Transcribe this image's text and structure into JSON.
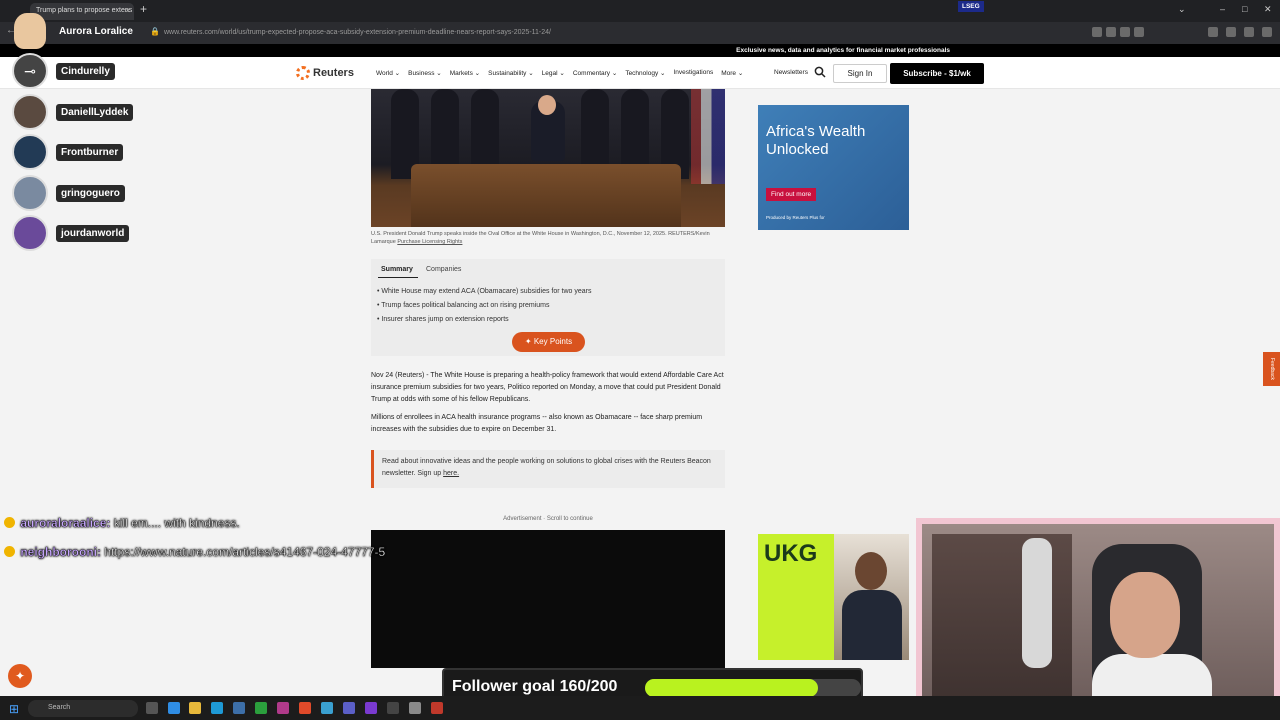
{
  "browser": {
    "tab_title": "Trump plans to propose extens",
    "tab_close": "×",
    "new_tab": "+",
    "url": "www.reuters.com/world/us/trump-expected-propose-aca-subsidy-extension-premium-deadline-nears-report-says-2025-11-24/"
  },
  "header": {
    "promo_text": "Exclusive news, data and analytics for financial market professionals",
    "promo_badge": "LSEG",
    "logo": "Reuters",
    "nav": [
      "World",
      "Business",
      "Markets",
      "Sustainability",
      "Legal",
      "Commentary",
      "Technology",
      "Investigations",
      "More"
    ],
    "newsletters": "Newsletters",
    "sign_in": "Sign In",
    "subscribe": "Subscribe - $1/wk"
  },
  "article": {
    "caption": "U.S. President Donald Trump speaks inside the Oval Office at the White House in Washington, D.C., November 12, 2025. REUTERS/Kevin Lamarque",
    "caption_link": "Purchase Licensing Rights",
    "tabs": {
      "summary": "Summary",
      "companies": "Companies"
    },
    "bullets": [
      "White House may extend ACA (Obamacare) subsidies for two years",
      "Trump faces political balancing act on rising premiums",
      "Insurer shares jump on extension reports"
    ],
    "key_points": "Key Points",
    "paragraphs": [
      "Nov 24 (Reuters) - The White House is preparing a health-policy framework that would extend Affordable Care Act insurance premium subsidies for two years, Politico reported on Monday, a move that could put President Donald Trump at odds with some of his fellow Republicans.",
      "Millions of enrollees in ACA health insurance programs -- also known as Obamacare -- face sharp premium increases with the subsidies due to expire on December 31."
    ],
    "beacon_text": "Read about innovative ideas and the people working on solutions to global crises with the Reuters Beacon newsletter. Sign up",
    "beacon_link": "here.",
    "ad_label": "Advertisement · Scroll to continue"
  },
  "ads": {
    "africa_title": "Africa's Wealth Unlocked",
    "africa_button": "Find out more",
    "africa_small": "Produced by Reuters Plus for",
    "ukg_logo": "UKG"
  },
  "feedback": "Feedback",
  "stream": {
    "streamer": "Aurora Loralice",
    "chat_users": [
      "Cindurelly",
      "DaniellLyddek",
      "Frontburner",
      "gringoguero",
      "jourdanworld"
    ],
    "messages": [
      {
        "user": "auroraloraalice:",
        "text": "kill em.... with kindness."
      },
      {
        "user": "neighborooni:",
        "text": "https://www.nature.com/articles/s41467-024-47777-5"
      }
    ],
    "goal_label": "Follower goal 160/200",
    "goal_progress": 0.8
  },
  "taskbar": {
    "search": "Search"
  },
  "colors": {
    "accent": "#d9531e",
    "goal_fill": "#b9f21f"
  }
}
